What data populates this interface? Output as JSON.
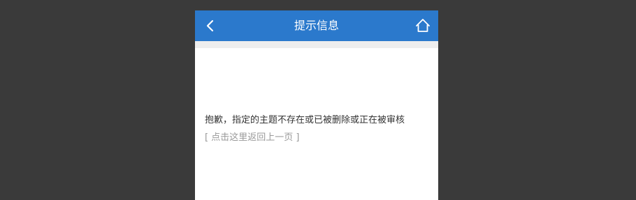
{
  "header": {
    "title": "提示信息",
    "back_icon": "chevron-left-icon",
    "home_icon": "home-icon"
  },
  "content": {
    "message": "抱歉，指定的主题不存在或已被删除或正在被审核",
    "back_link": "[ 点击这里返回上一页 ]"
  },
  "colors": {
    "header": "#2b79cc",
    "background": "#3a3a3a"
  }
}
